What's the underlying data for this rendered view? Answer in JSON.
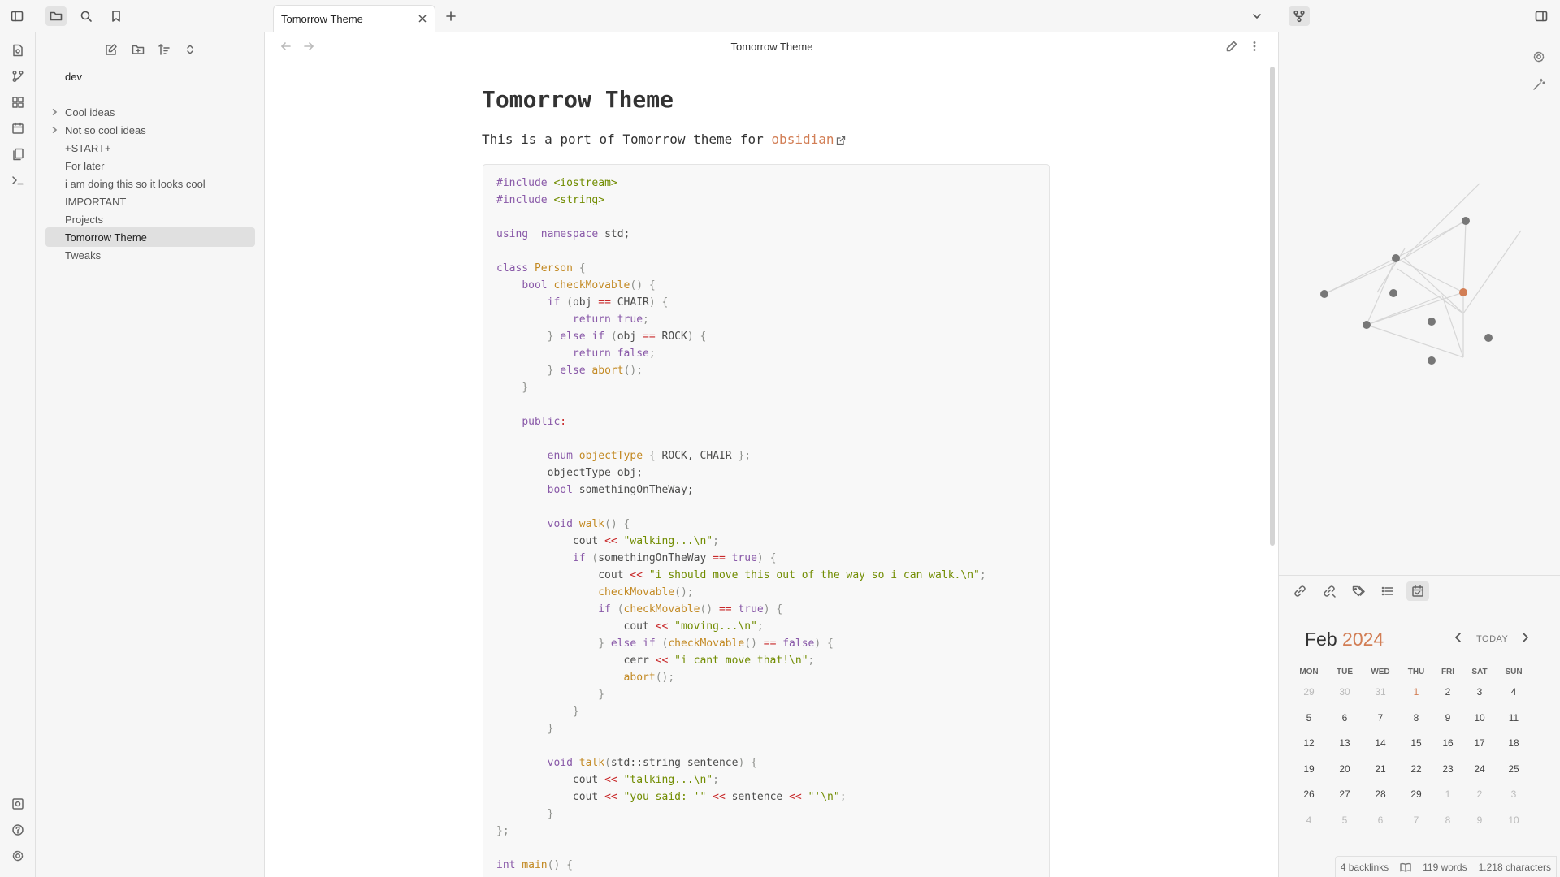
{
  "tab": {
    "title": "Tomorrow Theme"
  },
  "sidebar": {
    "vault_name": "dev",
    "items": [
      {
        "label": "Cool ideas",
        "folder": true
      },
      {
        "label": "Not so cool ideas",
        "folder": true
      },
      {
        "label": "+START+",
        "folder": false
      },
      {
        "label": "For later",
        "folder": false
      },
      {
        "label": "i am doing this so it looks cool",
        "folder": false
      },
      {
        "label": "IMPORTANT",
        "folder": false
      },
      {
        "label": "Projects",
        "folder": false
      },
      {
        "label": "Tomorrow Theme",
        "folder": false,
        "active": true
      },
      {
        "label": "Tweaks",
        "folder": false
      }
    ]
  },
  "main": {
    "view_title": "Tomorrow Theme",
    "heading": "Tomorrow Theme",
    "intro_text": "This is a port of Tomorrow theme for ",
    "link_text": "obsidian"
  },
  "code_lines": [
    [
      [
        "pp",
        "#include "
      ],
      [
        "inc",
        "<iostream>"
      ]
    ],
    [
      [
        "pp",
        "#include "
      ],
      [
        "inc",
        "<string>"
      ]
    ],
    [],
    [
      [
        "kw",
        "using"
      ],
      [
        "",
        "  "
      ],
      [
        "kw",
        "namespace"
      ],
      [
        "",
        " std;"
      ]
    ],
    [],
    [
      [
        "kw",
        "class"
      ],
      [
        "",
        " "
      ],
      [
        "ty",
        "Person"
      ],
      [
        "pu",
        " {"
      ]
    ],
    [
      [
        "",
        "    "
      ],
      [
        "kw",
        "bool"
      ],
      [
        "",
        " "
      ],
      [
        "fn",
        "checkMovable"
      ],
      [
        "pu",
        "() {"
      ]
    ],
    [
      [
        "",
        "        "
      ],
      [
        "kw",
        "if"
      ],
      [
        "pu",
        " ("
      ],
      [
        "",
        "obj "
      ],
      [
        "op",
        "=="
      ],
      [
        "",
        " CHAIR"
      ],
      [
        "pu",
        ") {"
      ]
    ],
    [
      [
        "",
        "            "
      ],
      [
        "kw",
        "return"
      ],
      [
        "",
        " "
      ],
      [
        "kw",
        "true"
      ],
      [
        "pu",
        ";"
      ]
    ],
    [
      [
        "",
        "        "
      ],
      [
        "pu",
        "} "
      ],
      [
        "kw",
        "else if"
      ],
      [
        "pu",
        " ("
      ],
      [
        "",
        "obj "
      ],
      [
        "op",
        "=="
      ],
      [
        "",
        " ROCK"
      ],
      [
        "pu",
        ") {"
      ]
    ],
    [
      [
        "",
        "            "
      ],
      [
        "kw",
        "return"
      ],
      [
        "",
        " "
      ],
      [
        "kw",
        "false"
      ],
      [
        "pu",
        ";"
      ]
    ],
    [
      [
        "",
        "        "
      ],
      [
        "pu",
        "} "
      ],
      [
        "kw",
        "else"
      ],
      [
        "",
        " "
      ],
      [
        "fn",
        "abort"
      ],
      [
        "pu",
        "();"
      ]
    ],
    [
      [
        "",
        "    "
      ],
      [
        "pu",
        "}"
      ]
    ],
    [],
    [
      [
        "",
        "    "
      ],
      [
        "kw",
        "public"
      ],
      [
        "op",
        ":"
      ]
    ],
    [],
    [
      [
        "",
        "        "
      ],
      [
        "kw",
        "enum"
      ],
      [
        "",
        " "
      ],
      [
        "ty",
        "objectType"
      ],
      [
        "pu",
        " { "
      ],
      [
        "",
        "ROCK, CHAIR"
      ],
      [
        "pu",
        " };"
      ]
    ],
    [
      [
        "",
        "        objectType obj;"
      ]
    ],
    [
      [
        "",
        "        "
      ],
      [
        "kw",
        "bool"
      ],
      [
        "",
        " somethingOnTheWay;"
      ]
    ],
    [],
    [
      [
        "",
        "        "
      ],
      [
        "kw",
        "void"
      ],
      [
        "",
        " "
      ],
      [
        "fn",
        "walk"
      ],
      [
        "pu",
        "() {"
      ]
    ],
    [
      [
        "",
        "            cout "
      ],
      [
        "op",
        "<<"
      ],
      [
        "",
        " "
      ],
      [
        "st",
        "\"walking...\\n\""
      ],
      [
        "pu",
        ";"
      ]
    ],
    [
      [
        "",
        "            "
      ],
      [
        "kw",
        "if"
      ],
      [
        "pu",
        " ("
      ],
      [
        "",
        "somethingOnTheWay "
      ],
      [
        "op",
        "=="
      ],
      [
        "",
        " "
      ],
      [
        "kw",
        "true"
      ],
      [
        "pu",
        ") {"
      ]
    ],
    [
      [
        "",
        "                cout "
      ],
      [
        "op",
        "<<"
      ],
      [
        "",
        " "
      ],
      [
        "st",
        "\"i should move this out of the way so i can walk.\\n\""
      ],
      [
        "pu",
        ";"
      ]
    ],
    [
      [
        "",
        "                "
      ],
      [
        "fn",
        "checkMovable"
      ],
      [
        "pu",
        "();"
      ]
    ],
    [
      [
        "",
        "                "
      ],
      [
        "kw",
        "if"
      ],
      [
        "pu",
        " ("
      ],
      [
        "fn",
        "checkMovable"
      ],
      [
        "pu",
        "() "
      ],
      [
        "op",
        "=="
      ],
      [
        "",
        " "
      ],
      [
        "kw",
        "true"
      ],
      [
        "pu",
        ") {"
      ]
    ],
    [
      [
        "",
        "                    cout "
      ],
      [
        "op",
        "<<"
      ],
      [
        "",
        " "
      ],
      [
        "st",
        "\"moving...\\n\""
      ],
      [
        "pu",
        ";"
      ]
    ],
    [
      [
        "",
        "                "
      ],
      [
        "pu",
        "} "
      ],
      [
        "kw",
        "else if"
      ],
      [
        "pu",
        " ("
      ],
      [
        "fn",
        "checkMovable"
      ],
      [
        "pu",
        "() "
      ],
      [
        "op",
        "=="
      ],
      [
        "",
        " "
      ],
      [
        "kw",
        "false"
      ],
      [
        "pu",
        ") {"
      ]
    ],
    [
      [
        "",
        "                    cerr "
      ],
      [
        "op",
        "<<"
      ],
      [
        "",
        " "
      ],
      [
        "st",
        "\"i cant move that!\\n\""
      ],
      [
        "pu",
        ";"
      ]
    ],
    [
      [
        "",
        "                    "
      ],
      [
        "fn",
        "abort"
      ],
      [
        "pu",
        "();"
      ]
    ],
    [
      [
        "",
        "                "
      ],
      [
        "pu",
        "}"
      ]
    ],
    [
      [
        "",
        "            "
      ],
      [
        "pu",
        "}"
      ]
    ],
    [
      [
        "",
        "        "
      ],
      [
        "pu",
        "}"
      ]
    ],
    [],
    [
      [
        "",
        "        "
      ],
      [
        "kw",
        "void"
      ],
      [
        "",
        " "
      ],
      [
        "fn",
        "talk"
      ],
      [
        "pu",
        "("
      ],
      [
        "",
        "std::string sentence"
      ],
      [
        "pu",
        ") {"
      ]
    ],
    [
      [
        "",
        "            cout "
      ],
      [
        "op",
        "<<"
      ],
      [
        "",
        " "
      ],
      [
        "st",
        "\"talking...\\n\""
      ],
      [
        "pu",
        ";"
      ]
    ],
    [
      [
        "",
        "            cout "
      ],
      [
        "op",
        "<<"
      ],
      [
        "",
        " "
      ],
      [
        "st",
        "\"you said: '\""
      ],
      [
        "",
        " "
      ],
      [
        "op",
        "<<"
      ],
      [
        "",
        " sentence "
      ],
      [
        "op",
        "<<"
      ],
      [
        "",
        " "
      ],
      [
        "st",
        "\"'\\n\""
      ],
      [
        "pu",
        ";"
      ]
    ],
    [
      [
        "",
        "        "
      ],
      [
        "pu",
        "}"
      ]
    ],
    [
      [
        "pu",
        "};"
      ]
    ],
    [],
    [
      [
        "kw",
        "int"
      ],
      [
        "",
        " "
      ],
      [
        "fn",
        "main"
      ],
      [
        "pu",
        "() {"
      ]
    ]
  ],
  "calendar": {
    "month": "Feb",
    "year": "2024",
    "today_label": "TODAY",
    "weekdays": [
      "MON",
      "TUE",
      "WED",
      "THU",
      "FRI",
      "SAT",
      "SUN"
    ],
    "weeks": [
      [
        {
          "d": "29",
          "dim": true
        },
        {
          "d": "30",
          "dim": true
        },
        {
          "d": "31",
          "dim": true
        },
        {
          "d": "1",
          "today": true
        },
        {
          "d": "2"
        },
        {
          "d": "3"
        },
        {
          "d": "4"
        }
      ],
      [
        {
          "d": "5"
        },
        {
          "d": "6"
        },
        {
          "d": "7"
        },
        {
          "d": "8"
        },
        {
          "d": "9"
        },
        {
          "d": "10"
        },
        {
          "d": "11"
        }
      ],
      [
        {
          "d": "12"
        },
        {
          "d": "13"
        },
        {
          "d": "14"
        },
        {
          "d": "15"
        },
        {
          "d": "16"
        },
        {
          "d": "17"
        },
        {
          "d": "18"
        }
      ],
      [
        {
          "d": "19"
        },
        {
          "d": "20"
        },
        {
          "d": "21"
        },
        {
          "d": "22"
        },
        {
          "d": "23"
        },
        {
          "d": "24"
        },
        {
          "d": "25"
        }
      ],
      [
        {
          "d": "26"
        },
        {
          "d": "27"
        },
        {
          "d": "28"
        },
        {
          "d": "29"
        },
        {
          "d": "1",
          "dim": true
        },
        {
          "d": "2",
          "dim": true
        },
        {
          "d": "3",
          "dim": true
        }
      ],
      [
        {
          "d": "4",
          "dim": true
        },
        {
          "d": "5",
          "dim": true
        },
        {
          "d": "6",
          "dim": true
        },
        {
          "d": "7",
          "dim": true
        },
        {
          "d": "8",
          "dim": true
        },
        {
          "d": "9",
          "dim": true
        },
        {
          "d": "10",
          "dim": true
        }
      ]
    ]
  },
  "status": {
    "backlinks": "4 backlinks",
    "words": "119 words",
    "characters": "1.218 characters"
  },
  "colors": {
    "accent": "#d27e55",
    "keyword": "#8959a8",
    "type": "#c38a24",
    "string": "#718c00",
    "operator": "#c82829"
  }
}
